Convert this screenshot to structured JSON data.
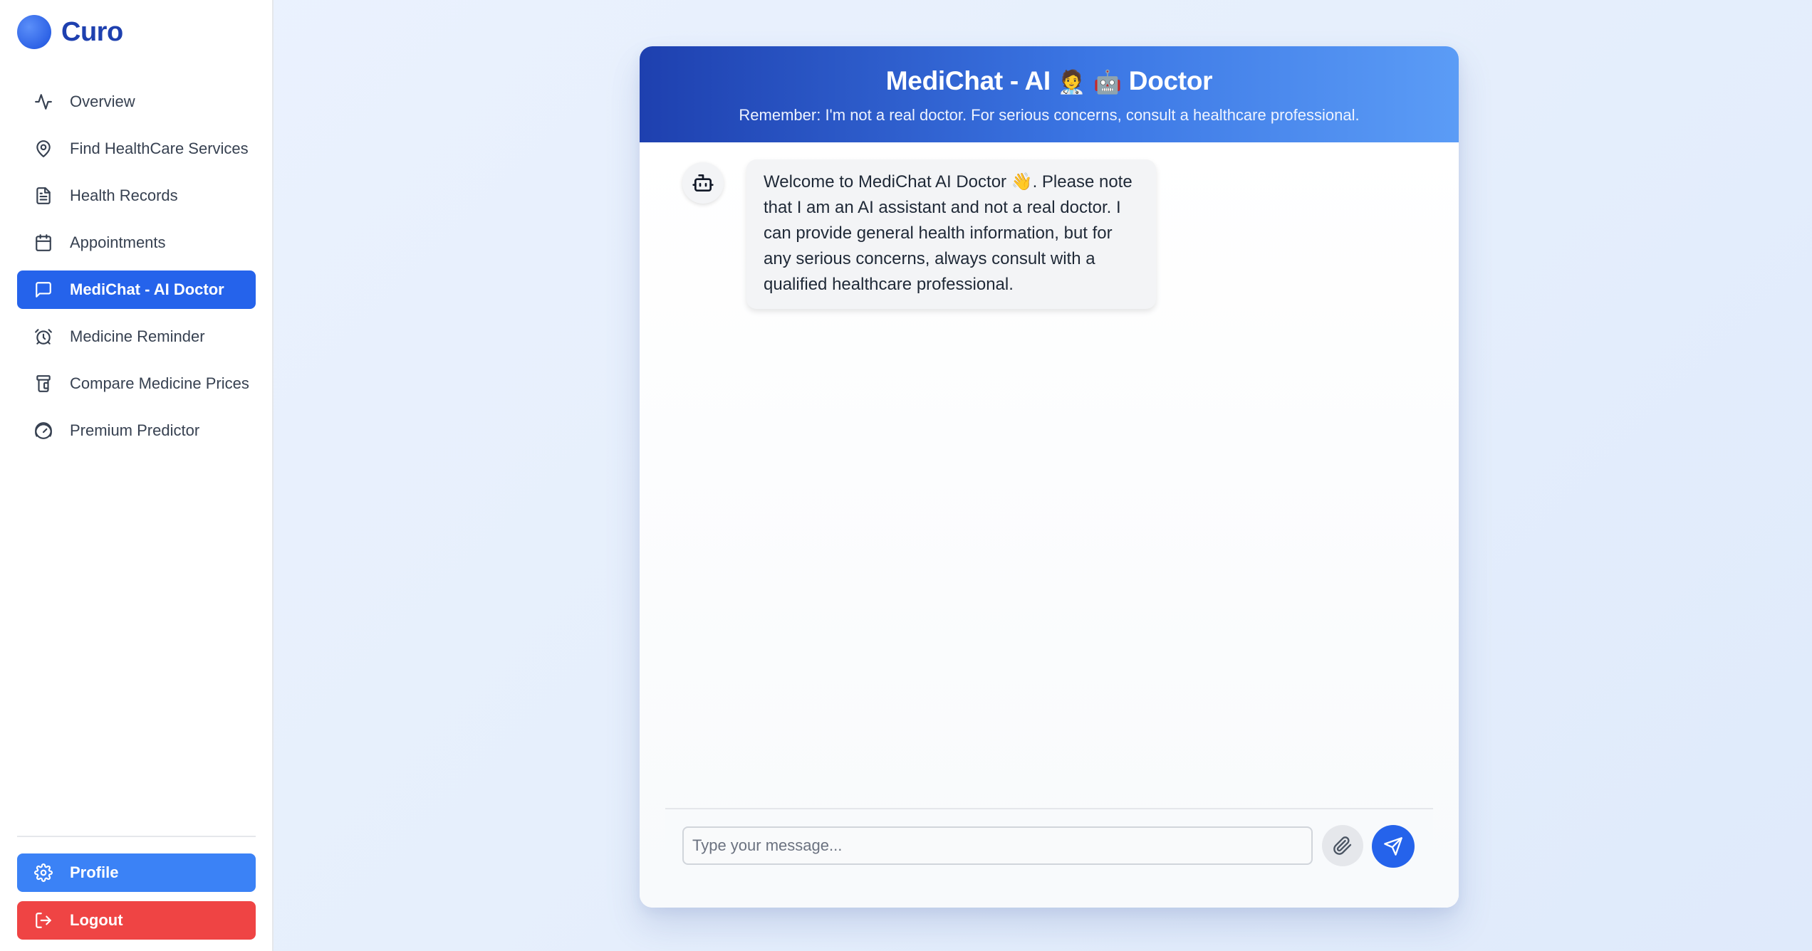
{
  "app": {
    "brand_name": "Curo"
  },
  "sidebar": {
    "items": [
      {
        "label": "Overview",
        "icon": "activity-icon"
      },
      {
        "label": "Find HealthCare Services",
        "icon": "map-pin-icon"
      },
      {
        "label": "Health Records",
        "icon": "file-text-icon"
      },
      {
        "label": "Appointments",
        "icon": "calendar-icon"
      },
      {
        "label": "MediChat - AI Doctor",
        "icon": "message-square-icon",
        "active": true
      },
      {
        "label": "Medicine Reminder",
        "icon": "alarm-clock-icon"
      },
      {
        "label": "Compare Medicine Prices",
        "icon": "pill-bottle-icon"
      },
      {
        "label": "Premium Predictor",
        "icon": "gauge-icon"
      }
    ],
    "profile_label": "Profile",
    "logout_label": "Logout"
  },
  "chat": {
    "title_prefix": "MediChat - AI",
    "title_emojis": "🧑‍⚕️ 🤖",
    "title_suffix": "Doctor",
    "subtitle": "Remember: I'm not a real doctor. For serious concerns, consult a healthcare professional.",
    "messages": [
      {
        "sender": "bot",
        "text": "Welcome to MediChat AI Doctor 👋. Please note that I am an AI assistant and not a real doctor. I can provide general health information, but for any serious concerns, always consult with a qualified healthcare professional."
      }
    ],
    "input_placeholder": "Type your message...",
    "input_value": ""
  },
  "colors": {
    "accent": "#2563eb",
    "brand_text": "#1e40af",
    "profile_button": "#3b82f6",
    "logout_button": "#ef4444"
  }
}
